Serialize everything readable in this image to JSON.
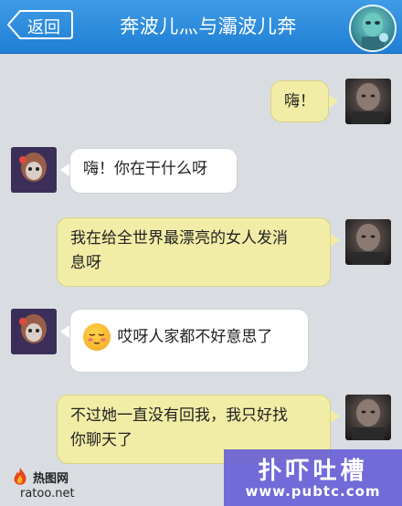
{
  "header": {
    "back_label": "返回",
    "title": "奔波儿灬与灞波儿奔",
    "avatar_icon": "contact-avatar-icon"
  },
  "messages": [
    {
      "side": "out",
      "text": "嗨！"
    },
    {
      "side": "in",
      "text": "嗨！你在干什么呀"
    },
    {
      "side": "out",
      "line1": "我在给全世界最漂亮的女人发消",
      "line2": "息呀"
    },
    {
      "side": "in",
      "emoji": "shy-face-emoji",
      "text": "哎呀人家都不好意思了"
    },
    {
      "side": "out",
      "line1": "不过她一直没有回我，我只好找",
      "line2": "你聊天了"
    }
  ],
  "watermarks": {
    "left_logo": "热图网",
    "left_url": "ratoo.net",
    "right_brand": "扑吓吐槽",
    "right_url": "www.pubtc.com"
  },
  "colors": {
    "header_blue": "#2b8ce0",
    "outgoing_bubble": "#f2eda6",
    "incoming_bubble": "#ffffff",
    "background": "#d9dde2",
    "watermark_purple": "#625ad6"
  }
}
